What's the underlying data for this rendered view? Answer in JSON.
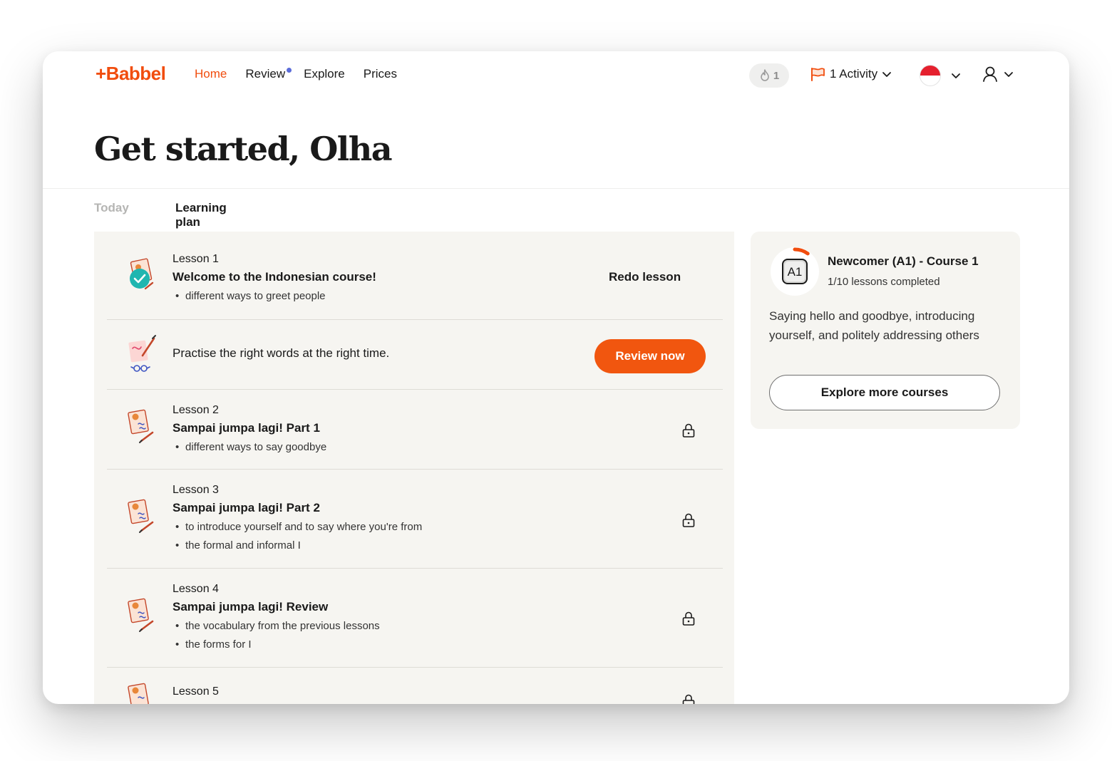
{
  "brand": {
    "logo": "+Babbel",
    "accent": "#f14d0e"
  },
  "nav": {
    "links": [
      {
        "label": "Home",
        "active": true
      },
      {
        "label": "Review",
        "has_dot": true
      },
      {
        "label": "Explore"
      },
      {
        "label": "Prices"
      }
    ],
    "streak_count": "1",
    "activity_label": "1 Activity"
  },
  "page": {
    "title": "Get started, Olha"
  },
  "tabs": [
    {
      "label": "Today",
      "active": false
    },
    {
      "label": "Learning plan",
      "active": true
    }
  ],
  "plan": {
    "lesson1": {
      "number": "Lesson 1",
      "title": "Welcome to the Indonesian course!",
      "bullets": [
        "different ways to greet people"
      ],
      "action": "Redo lesson",
      "completed": true
    },
    "review": {
      "text": "Practise the right words at the right time.",
      "action": "Review now"
    },
    "lesson2": {
      "number": "Lesson 2",
      "title": "Sampai jumpa lagi! Part 1",
      "bullets": [
        "different ways to say goodbye"
      ],
      "locked": true
    },
    "lesson3": {
      "number": "Lesson 3",
      "title": "Sampai jumpa lagi! Part 2",
      "bullets": [
        "to introduce yourself and to say where you're from",
        "the formal and informal I"
      ],
      "locked": true
    },
    "lesson4": {
      "number": "Lesson 4",
      "title": "Sampai jumpa lagi! Review",
      "bullets": [
        "the vocabulary from the previous lessons",
        "the forms for I"
      ],
      "locked": true
    },
    "lesson5": {
      "number": "Lesson 5",
      "locked": true
    }
  },
  "course": {
    "badge": "A1",
    "name": "Newcomer (A1) - Course 1",
    "progress": "1/10 lessons completed",
    "progress_fraction": 0.1,
    "description": "Saying hello and goodbye, introducing yourself, and politely addressing others",
    "explore_label": "Explore more courses"
  },
  "icons": {
    "streak": "flame-icon",
    "activity": "flag-icon",
    "language": "indonesia-flag-icon",
    "user": "user-icon",
    "lock": "lock-icon"
  }
}
